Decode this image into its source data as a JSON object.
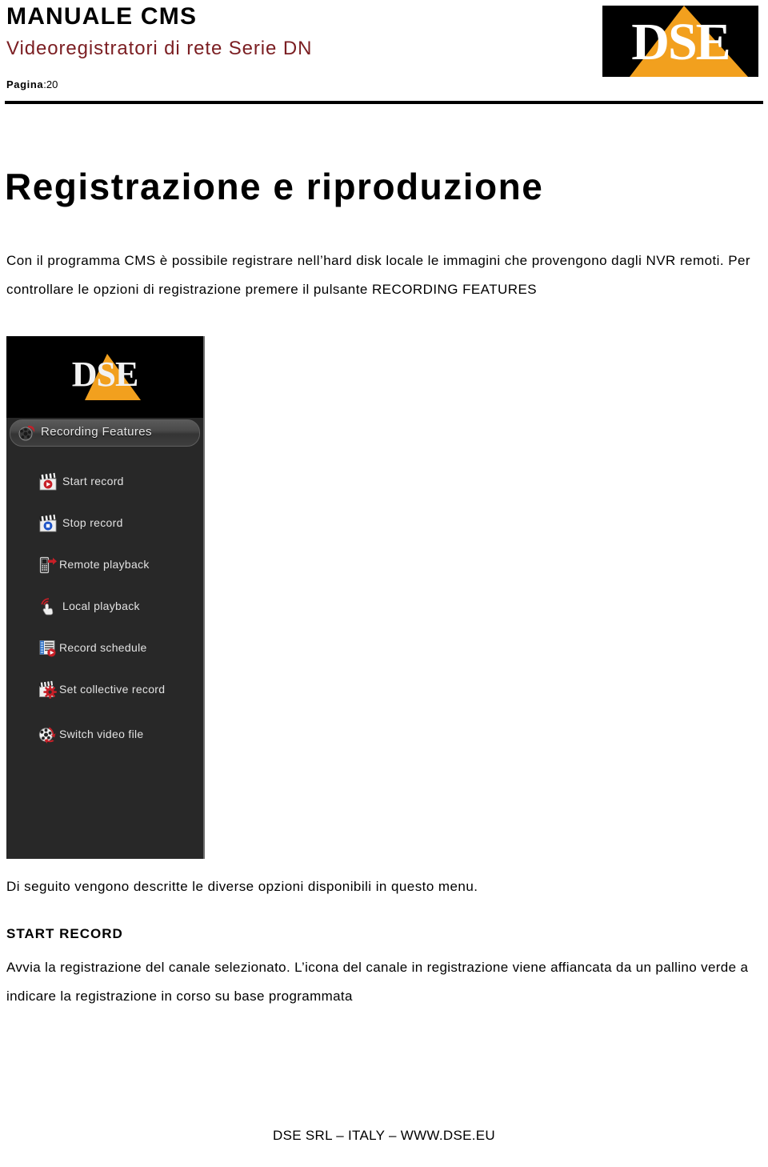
{
  "header": {
    "manual_title": "MANUALE CMS",
    "manual_subtitle": "Videoregistratori di rete Serie DN",
    "page_label": "Pagina",
    "page_separator": ":",
    "page_value": "20",
    "logo_text": "DSE",
    "logo_bg": "#000000",
    "logo_accent": "#F2A01E",
    "subtitle_color": "#7B1E22"
  },
  "content": {
    "page_title": "Registrazione e riproduzione",
    "intro_paragraph": "Con il programma CMS è possibile registrare nell’hard disk locale le immagini che provengono dagli NVR remoti. Per controllare le opzioni di registrazione premere il pulsante RECORDING FEATURES",
    "description_paragraph": "Di seguito vengono descritte le diverse opzioni disponibili in questo menu.",
    "section_heading": "START RECORD",
    "section_body": "Avvia la registrazione del canale selezionato. L’icona del canale in registrazione viene affiancata da un pallino verde a indicare la registrazione in corso su base programmata"
  },
  "cms_screenshot": {
    "panel_bg": "#282828",
    "logo_text": "DSE",
    "section_bar": {
      "label": "Recording Features",
      "icon": "film-reel-icon"
    },
    "menu_items": [
      {
        "label": "Start record",
        "icon": "clapperboard-play-icon"
      },
      {
        "label": "Stop record",
        "icon": "clapperboard-stop-icon"
      },
      {
        "label": "Remote playback",
        "icon": "remote-device-arrow-icon"
      },
      {
        "label": "Local playback",
        "icon": "hand-pointer-icon"
      },
      {
        "label": "Record schedule",
        "icon": "schedule-list-play-icon"
      },
      {
        "label": "Set collective record",
        "icon": "clapperboard-gear-icon"
      },
      {
        "label": "Switch video file",
        "icon": "film-reel-switch-icon"
      }
    ]
  },
  "footer": {
    "text": "DSE SRL – ITALY – WWW.DSE.EU"
  }
}
